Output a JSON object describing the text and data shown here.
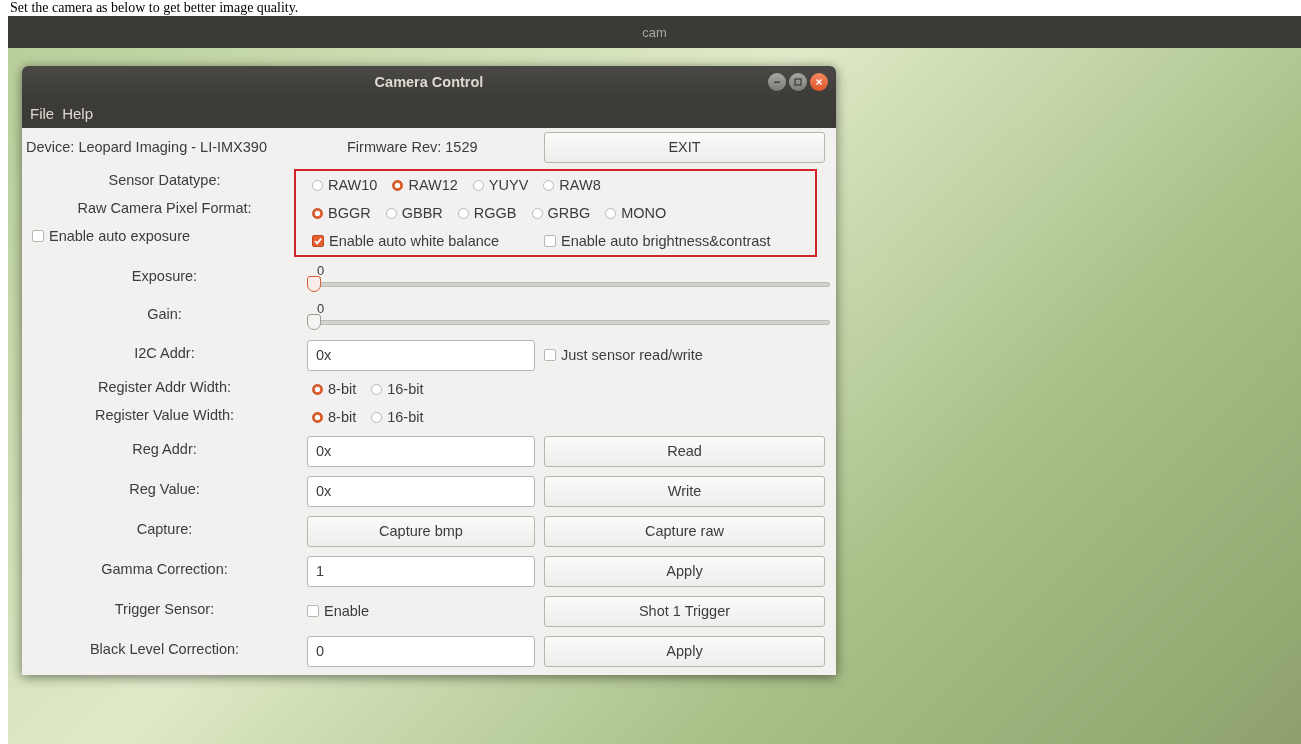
{
  "caption": "Set the camera as below to get better image quality.",
  "window": {
    "title": "cam"
  },
  "dialog": {
    "title": "Camera Control",
    "menu": [
      "File",
      "Help"
    ],
    "header": {
      "device": "Device: Leopard Imaging - LI-IMX390",
      "firmware": "Firmware Rev: 1529",
      "button": "EXIT"
    },
    "sections": [
      {
        "highlighted": true,
        "rows": [
          {
            "left": {
              "kind": "label",
              "text": "Sensor Datatype:"
            },
            "right": [
              {
                "kind": "radio_group",
                "options": [
                  {
                    "label": "RAW10",
                    "selected": false
                  },
                  {
                    "label": "RAW12",
                    "selected": true
                  },
                  {
                    "label": "YUYV",
                    "selected": false
                  },
                  {
                    "label": "RAW8",
                    "selected": false
                  }
                ]
              }
            ]
          },
          {
            "left": {
              "kind": "label",
              "text": "Raw Camera Pixel Format:"
            },
            "right": [
              {
                "kind": "radio_group",
                "options": [
                  {
                    "label": "BGGR",
                    "selected": true
                  },
                  {
                    "label": "GBBR",
                    "selected": false
                  },
                  {
                    "label": "RGGB",
                    "selected": false
                  },
                  {
                    "label": "GRBG",
                    "selected": false
                  },
                  {
                    "label": "MONO",
                    "selected": false
                  }
                ]
              }
            ]
          },
          {
            "left": {
              "kind": "checkbox",
              "label": "Enable auto exposure",
              "checked": false
            },
            "right": [
              {
                "kind": "checkbox",
                "label": "Enable auto white balance",
                "checked": true
              },
              {
                "kind": "checkbox",
                "label": "Enable auto brightness&contrast",
                "checked": false
              }
            ]
          }
        ]
      },
      {
        "highlighted": false,
        "rows": [
          {
            "left": {
              "kind": "label",
              "text": "Exposure:"
            },
            "right": [
              {
                "kind": "slider",
                "reading": "0",
                "level": 0,
                "focused": true
              }
            ]
          },
          {
            "left": {
              "kind": "label",
              "text": "Gain:"
            },
            "right": [
              {
                "kind": "slider",
                "reading": "0",
                "level": 0,
                "focused": false
              }
            ]
          },
          {
            "left": {
              "kind": "label",
              "text": "I2C Addr:"
            },
            "right": [
              {
                "kind": "field",
                "value": "0x"
              },
              {
                "kind": "checkbox",
                "label": "Just sensor read/write",
                "checked": false
              }
            ]
          },
          {
            "left": {
              "kind": "label",
              "text": "Register Addr Width:"
            },
            "right": [
              {
                "kind": "radio_group",
                "options": [
                  {
                    "label": "8-bit",
                    "selected": true
                  },
                  {
                    "label": "16-bit",
                    "selected": false
                  }
                ]
              }
            ]
          },
          {
            "left": {
              "kind": "label",
              "text": "Register Value Width:"
            },
            "right": [
              {
                "kind": "radio_group",
                "options": [
                  {
                    "label": "8-bit",
                    "selected": true
                  },
                  {
                    "label": "16-bit",
                    "selected": false
                  }
                ]
              }
            ]
          },
          {
            "left": {
              "kind": "label",
              "text": "Reg Addr:"
            },
            "right": [
              {
                "kind": "field",
                "value": "0x"
              },
              {
                "kind": "button",
                "label": "Read"
              }
            ]
          },
          {
            "left": {
              "kind": "label",
              "text": "Reg Value:"
            },
            "right": [
              {
                "kind": "field",
                "value": "0x"
              },
              {
                "kind": "button",
                "label": "Write"
              }
            ]
          },
          {
            "left": {
              "kind": "label",
              "text": "Capture:"
            },
            "right": [
              {
                "kind": "button",
                "label": "Capture bmp"
              },
              {
                "kind": "button",
                "label": "Capture raw"
              }
            ]
          },
          {
            "left": {
              "kind": "label",
              "text": "Gamma Correction:"
            },
            "right": [
              {
                "kind": "field",
                "value": "1"
              },
              {
                "kind": "button",
                "label": "Apply"
              }
            ]
          },
          {
            "left": {
              "kind": "label",
              "text": "Trigger Sensor:"
            },
            "right": [
              {
                "kind": "checkbox",
                "label": "Enable",
                "checked": false
              },
              {
                "kind": "button",
                "label": "Shot 1 Trigger"
              }
            ]
          },
          {
            "left": {
              "kind": "label",
              "text": "Black Level Correction:"
            },
            "right": [
              {
                "kind": "field",
                "value": "0"
              },
              {
                "kind": "button",
                "label": "Apply"
              }
            ]
          }
        ]
      }
    ]
  }
}
